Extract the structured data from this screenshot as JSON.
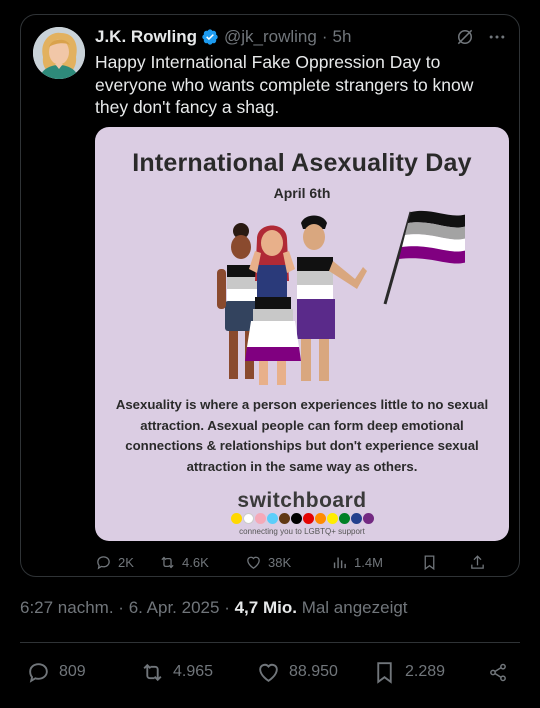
{
  "tweet": {
    "author_name": "J.K. Rowling",
    "handle": "@jk_rowling",
    "separator": "·",
    "time_ago": "5h",
    "text": "Happy International Fake Oppression Day to everyone who wants complete strangers to know they don't fancy a shag.",
    "verified": true,
    "accent_color": "#1d9bf0"
  },
  "media": {
    "title": "International Asexuality Day",
    "date": "April 6th",
    "description": "Asexuality is where a person experiences little to no sexual attraction. Asexual people can form deep emotional connections & relationships but don't experience sexual attraction in the same way as others.",
    "brand": "switchboard",
    "tagline": "connecting you to LGBTQ+ support",
    "background_color": "#dbcde3",
    "flag_colors": [
      "#000000",
      "#a3a3a3",
      "#ffffff",
      "#800080"
    ],
    "dot_colors": [
      "#ffd800",
      "#ffffff",
      "#f5a9b8",
      "#5bcefa",
      "#613915",
      "#000000",
      "#e40303",
      "#ff8c00",
      "#ffed00",
      "#008026",
      "#24408e",
      "#732982"
    ]
  },
  "card_actions": {
    "replies": "2K",
    "reposts": "4.6K",
    "likes": "38K",
    "views": "1.4M"
  },
  "detail": {
    "timestamp": "6:27 nachm.",
    "dot": "·",
    "date": "6. Apr. 2025",
    "views": "4,7 Mio.",
    "views_label": "Mal angezeigt"
  },
  "stats": {
    "replies": "809",
    "reposts": "4.965",
    "likes": "88.950",
    "bookmarks": "2.289"
  }
}
